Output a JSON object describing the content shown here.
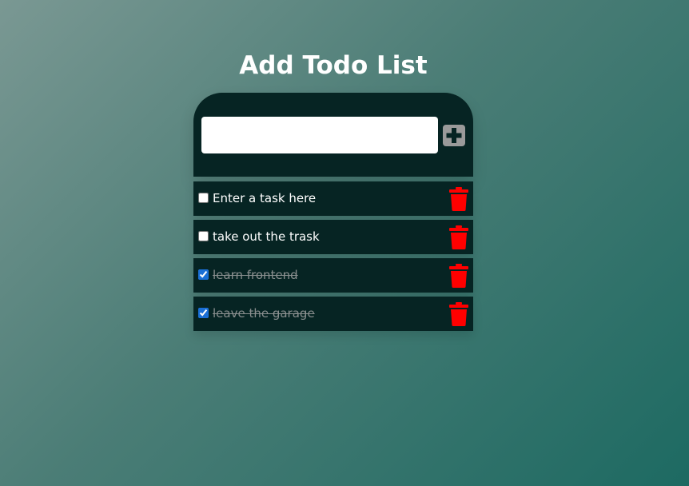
{
  "header": {
    "title": "Add Todo List"
  },
  "input": {
    "value": "",
    "placeholder": ""
  },
  "add_button": {
    "icon": "plus-icon",
    "color": "#9a9a9a"
  },
  "todos": [
    {
      "text": "Enter a task here",
      "checked": false
    },
    {
      "text": "take out the trask",
      "checked": false
    },
    {
      "text": "learn frontend",
      "checked": true
    },
    {
      "text": "leave the garage",
      "checked": true
    }
  ],
  "delete_icon": {
    "icon": "trash-icon",
    "color": "#ff0000"
  },
  "colors": {
    "card": "#062423",
    "background_start": "#7a9893",
    "background_end": "#1d6a62",
    "completed_text": "#8a8f8f"
  }
}
